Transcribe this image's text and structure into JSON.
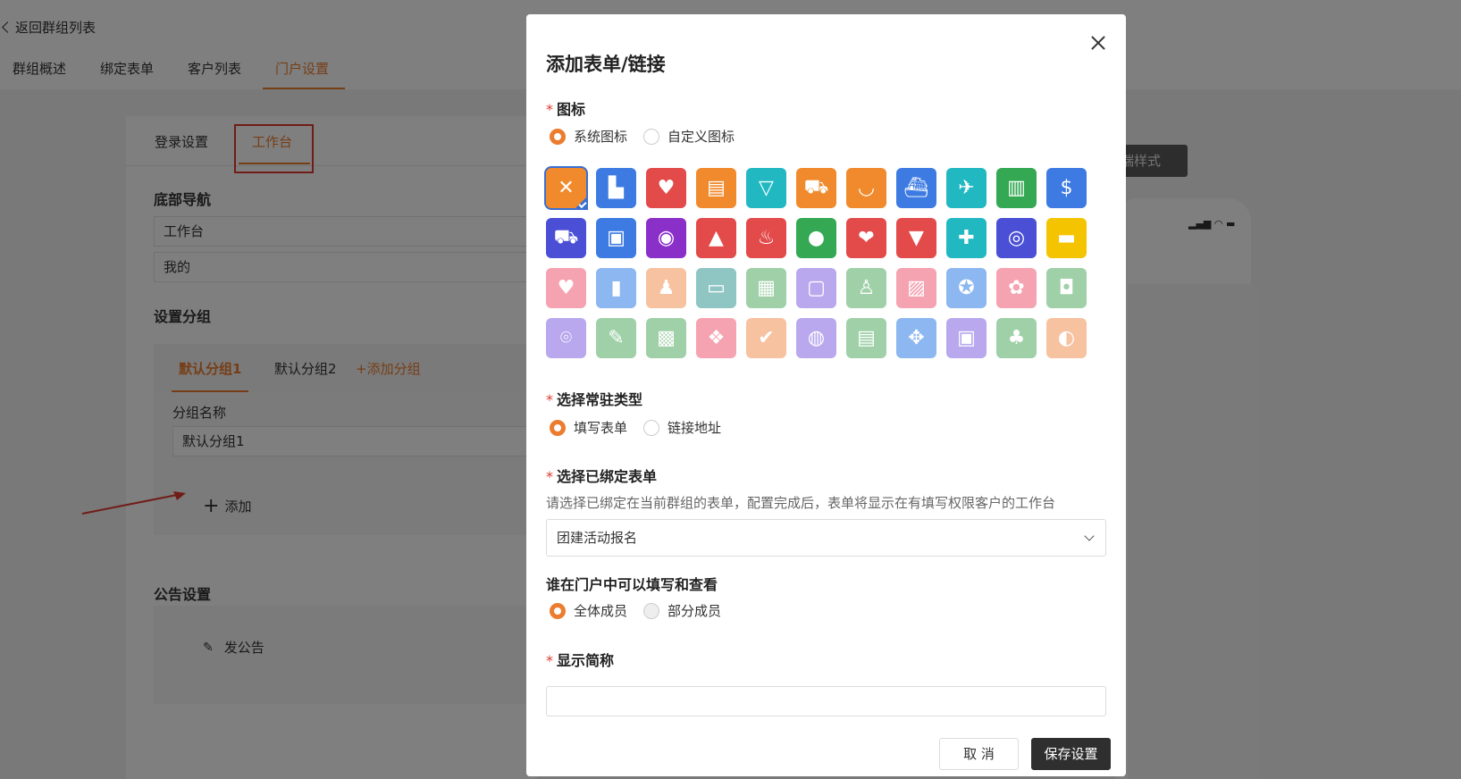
{
  "header": {
    "back_label": "返回群组列表",
    "tabs": [
      "群组概述",
      "绑定表单",
      "客户列表",
      "门户设置"
    ],
    "active_tab": "门户设置"
  },
  "settings": {
    "sub_tabs": [
      "登录设置",
      "工作台"
    ],
    "bottom_nav_title": "底部导航",
    "bottom_nav_items": [
      "工作台",
      "我的"
    ],
    "group_title": "设置分组",
    "group_tabs": [
      "默认分组1",
      "默认分组2",
      "+添加分组"
    ],
    "group_name_label": "分组名称",
    "group_name_value": "默认分组1",
    "add_label": "添加",
    "notice_title": "公告设置",
    "notice_label": "发公告"
  },
  "preview": {
    "tag_label": "端样式"
  },
  "modal": {
    "title": "添加表单/链接",
    "icon_label": "图标",
    "icon_options": [
      "系统图标",
      "自定义图标"
    ],
    "type_label": "选择常驻类型",
    "type_options": [
      "填写表单",
      "链接地址"
    ],
    "form_label": "选择已绑定表单",
    "form_hint": "请选择已绑定在当前群组的表单，配置完成后，表单将显示在有填写权限客户的工作台",
    "form_selected": "团建活动报名",
    "who_label": "谁在门户中可以填写和查看",
    "who_options": [
      "全体成员",
      "部分成员"
    ],
    "short_label": "显示简称",
    "cancel_label": "取 消",
    "save_label": "保存设置"
  },
  "icons": [
    {
      "name": "fork-knife-icon",
      "color": "#f08a2c",
      "glyph": "✕"
    },
    {
      "name": "factory-icon",
      "color": "#3d7be3",
      "glyph": "▙"
    },
    {
      "name": "heart-icon",
      "color": "#e34a4a",
      "glyph": "♥"
    },
    {
      "name": "document-icon",
      "color": "#f08a2c",
      "glyph": "▤"
    },
    {
      "name": "drink-cup-icon",
      "color": "#22b8c2",
      "glyph": "▽"
    },
    {
      "name": "shopping-cart-icon",
      "color": "#f08a2c",
      "glyph": "⛟"
    },
    {
      "name": "bowl-icon",
      "color": "#f08a2c",
      "glyph": "◡"
    },
    {
      "name": "ship-icon",
      "color": "#3d7be3",
      "glyph": "⛴"
    },
    {
      "name": "airplane-icon",
      "color": "#22b8c2",
      "glyph": "✈"
    },
    {
      "name": "book-icon",
      "color": "#34a853",
      "glyph": "▥"
    },
    {
      "name": "dollar-coin-icon",
      "color": "#3d7be3",
      "glyph": "$"
    },
    {
      "name": "truck-icon",
      "color": "#4a4fd6",
      "glyph": "⛟"
    },
    {
      "name": "taxi-icon",
      "color": "#3d7be3",
      "glyph": "▣"
    },
    {
      "name": "camera-icon",
      "color": "#8b2fc9",
      "glyph": "◉"
    },
    {
      "name": "dress-icon",
      "color": "#e34a4a",
      "glyph": "▲"
    },
    {
      "name": "cake-icon",
      "color": "#e34a4a",
      "glyph": "♨"
    },
    {
      "name": "person-icon",
      "color": "#34a853",
      "glyph": "●"
    },
    {
      "name": "heart-hand-icon",
      "color": "#e34a4a",
      "glyph": "❤"
    },
    {
      "name": "graduation-cap-icon",
      "color": "#e34a4a",
      "glyph": "▼"
    },
    {
      "name": "medical-kit-icon",
      "color": "#22b8c2",
      "glyph": "✚"
    },
    {
      "name": "bicycle-icon",
      "color": "#4a4fd6",
      "glyph": "◎"
    },
    {
      "name": "tshirt-icon",
      "color": "#f5c400",
      "glyph": "▬"
    },
    {
      "name": "hand-heart-icon",
      "color": "#f5a3b0",
      "glyph": "♥"
    },
    {
      "name": "bar-chart-icon",
      "color": "#8cb7f0",
      "glyph": "▮"
    },
    {
      "name": "presenter-icon",
      "color": "#f7c2a0",
      "glyph": "♟"
    },
    {
      "name": "presentation-board-icon",
      "color": "#8fc6c4",
      "glyph": "▭"
    },
    {
      "name": "calculator-icon",
      "color": "#9fd0a8",
      "glyph": "▦"
    },
    {
      "name": "computer-user-icon",
      "color": "#b9a8ee",
      "glyph": "▢"
    },
    {
      "name": "people-pair-icon",
      "color": "#9fd0a8",
      "glyph": "♙"
    },
    {
      "name": "picture-icon",
      "color": "#f5a3b0",
      "glyph": "▨"
    },
    {
      "name": "medal-icon",
      "color": "#8cb7f0",
      "glyph": "✪"
    },
    {
      "name": "laurel-award-icon",
      "color": "#f5a3b0",
      "glyph": "✿"
    },
    {
      "name": "hot-drink-icon",
      "color": "#9fd0a8",
      "glyph": "◘"
    },
    {
      "name": "map-pin-icon",
      "color": "#b9a8ee",
      "glyph": "⌾"
    },
    {
      "name": "form-edit-icon",
      "color": "#9fd0a8",
      "glyph": "✎"
    },
    {
      "name": "hospital-icon",
      "color": "#9fd0a8",
      "glyph": "▩"
    },
    {
      "name": "money-hand-icon",
      "color": "#f5a3b0",
      "glyph": "❖"
    },
    {
      "name": "chat-check-icon",
      "color": "#f7c2a0",
      "glyph": "✔"
    },
    {
      "name": "fingerprint-icon",
      "color": "#b9a8ee",
      "glyph": "◍"
    },
    {
      "name": "screen-chat-icon",
      "color": "#9fd0a8",
      "glyph": "▤"
    },
    {
      "name": "gamepad-icon",
      "color": "#8cb7f0",
      "glyph": "✥"
    },
    {
      "name": "lock-hand-icon",
      "color": "#b9a8ee",
      "glyph": "▣"
    },
    {
      "name": "tree-icon",
      "color": "#9fd0a8",
      "glyph": "♣"
    },
    {
      "name": "toggle-switch-icon",
      "color": "#f7c2a0",
      "glyph": "◐"
    }
  ]
}
